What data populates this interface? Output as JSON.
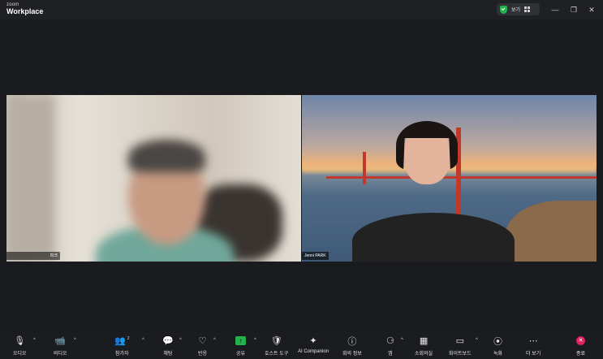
{
  "titlebar": {
    "brand_small": "zoom",
    "brand_large": "Workplace",
    "view_label": "보기",
    "minimize": "—",
    "restore": "❐",
    "close": "✕"
  },
  "tiles": [
    {
      "name": "피크"
    },
    {
      "name": "Jenni PARK"
    }
  ],
  "toolbar": {
    "audio": "오디오",
    "video": "비디오",
    "participants": "참가자",
    "participants_count": "2",
    "chat": "채팅",
    "reactions": "반응",
    "share": "공유",
    "host_tools": "호스트 도구",
    "ai_companion": "AI Companion",
    "meeting_info": "회의 정보",
    "apps": "앱",
    "breakout": "소회의실",
    "whiteboard": "화이트보드",
    "record": "녹화",
    "more": "더 보기",
    "end": "종료"
  },
  "colors": {
    "share_green": "#22b14c",
    "end_red": "#e0245e",
    "security_green": "#22b14c"
  }
}
